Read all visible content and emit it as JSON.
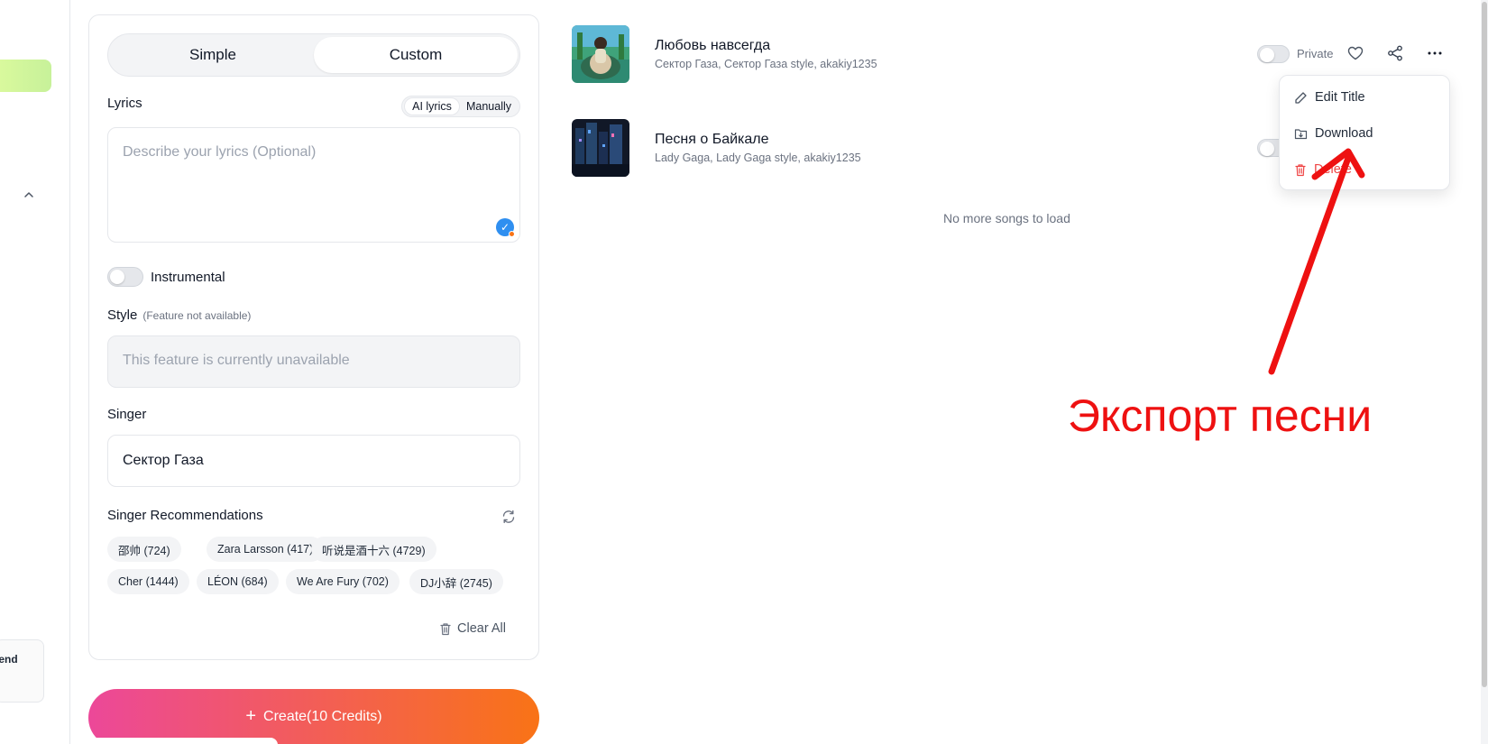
{
  "sidebar": {
    "friend_label": "iend"
  },
  "mode_switch": {
    "simple": "Simple",
    "custom": "Custom",
    "selected": "Custom"
  },
  "lyrics": {
    "label": "Lyrics",
    "ai_option": "AI lyrics",
    "manual_option": "Manually",
    "placeholder": "Describe your lyrics (Optional)"
  },
  "instrumental": {
    "label": "Instrumental",
    "enabled": false
  },
  "style": {
    "label": "Style",
    "note": "(Feature not available)",
    "placeholder": "This feature is currently unavailable"
  },
  "singer": {
    "label": "Singer",
    "value": "Сектор Газа"
  },
  "recommendations": {
    "label": "Singer Recommendations",
    "chips": [
      "邵帅 (724)",
      "Zara Larsson (417)",
      "听说是酒十六 (4729)",
      "Cher (1444)",
      "LÉON (684)",
      "We Are Fury (702)",
      "DJ小辞 (2745)"
    ],
    "clear_all": "Clear All"
  },
  "create_button": {
    "label": "Create(10 Credits)"
  },
  "songs": [
    {
      "title": "Любовь навсегда",
      "meta": "Сектор Газа, Сектор Газа style, akakiy1235",
      "privacy": "Private"
    },
    {
      "title": "Песня о Байкале",
      "meta": "Lady Gaga, Lady Gaga style, akakiy1235"
    }
  ],
  "no_more": "No more songs to load",
  "menu": {
    "edit_title": "Edit Title",
    "download": "Download",
    "delete": "Delete"
  },
  "annotation": {
    "text": "Экспорт песни",
    "color": "#ee1111"
  },
  "colors": {
    "accent_start": "#ec4899",
    "accent_end": "#f97316",
    "danger": "#ef4444"
  }
}
